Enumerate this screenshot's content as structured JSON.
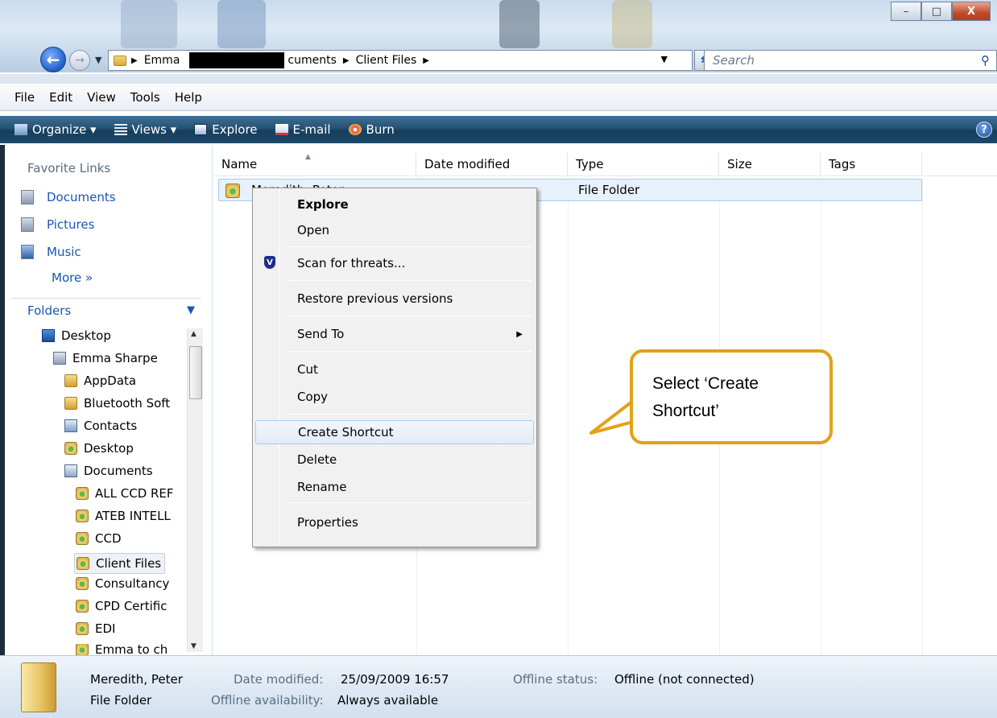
{
  "window": {
    "controls": {
      "minimize": "–",
      "maximize": "□",
      "close": "X"
    }
  },
  "address": {
    "crumbs": [
      "Emma",
      "cuments",
      "Client Files"
    ],
    "search_placeholder": "Search"
  },
  "menubar": [
    "File",
    "Edit",
    "View",
    "Tools",
    "Help"
  ],
  "commandbar": [
    {
      "label": "Organize ▾",
      "icon": "organize-icon"
    },
    {
      "label": "Views ▾",
      "icon": "views-icon"
    },
    {
      "label": "Explore",
      "icon": "explore-icon"
    },
    {
      "label": "E-mail",
      "icon": "email-icon"
    },
    {
      "label": "Burn",
      "icon": "burn-icon"
    }
  ],
  "left": {
    "favorites_title": "Favorite Links",
    "favorites": [
      "Documents",
      "Pictures",
      "Music"
    ],
    "more": "More  »",
    "folders_label": "Folders",
    "tree": [
      {
        "label": "Desktop",
        "icon": "desktop-icon"
      },
      {
        "label": "Emma Sharpe",
        "icon": "user-folder-icon"
      },
      {
        "label": "AppData",
        "icon": "folder-icon"
      },
      {
        "label": "Bluetooth Soft",
        "icon": "folder-icon"
      },
      {
        "label": "Contacts",
        "icon": "contacts-icon"
      },
      {
        "label": "Desktop",
        "icon": "shared-folder-icon"
      },
      {
        "label": "Documents",
        "icon": "documents-icon"
      },
      {
        "label": "ALL CCD REF",
        "icon": "shared-folder-icon"
      },
      {
        "label": "ATEB INTELL",
        "icon": "shared-folder-icon"
      },
      {
        "label": "CCD",
        "icon": "shared-folder-icon"
      },
      {
        "label": "Client Files",
        "icon": "shared-folder-icon",
        "selected": true
      },
      {
        "label": "Consultancy",
        "icon": "shared-folder-icon"
      },
      {
        "label": "CPD Certific",
        "icon": "shared-folder-icon"
      },
      {
        "label": "EDI",
        "icon": "shared-folder-icon"
      },
      {
        "label": "Emma to ch",
        "icon": "shared-folder-icon"
      }
    ]
  },
  "list": {
    "columns": [
      "Name",
      "Date modified",
      "Type",
      "Size",
      "Tags"
    ],
    "rows": [
      {
        "name": "Meredith, Peter",
        "date": "25/09/2009 16:57",
        "type": "File Folder",
        "size": "",
        "tags": ""
      }
    ]
  },
  "context_menu": {
    "items": [
      "Explore",
      "Open",
      "Scan for threats...",
      "Restore previous versions",
      "Send To",
      "Cut",
      "Copy",
      "Create Shortcut",
      "Delete",
      "Rename",
      "Properties"
    ]
  },
  "callout": {
    "text_line1": "Select ‘Create",
    "text_line2": "Shortcut’"
  },
  "details": {
    "name": "Meredith, Peter",
    "kind": "File Folder",
    "date_label": "Date modified:",
    "date_value": "25/09/2009 16:57",
    "availability_label": "Offline availability:",
    "availability_value": "Always available",
    "status_label": "Offline status:",
    "status_value": "Offline (not connected)"
  },
  "colors": {
    "accent": "#1a56b4",
    "callout_border": "#e1a11a",
    "cmdbar": "#255274"
  }
}
